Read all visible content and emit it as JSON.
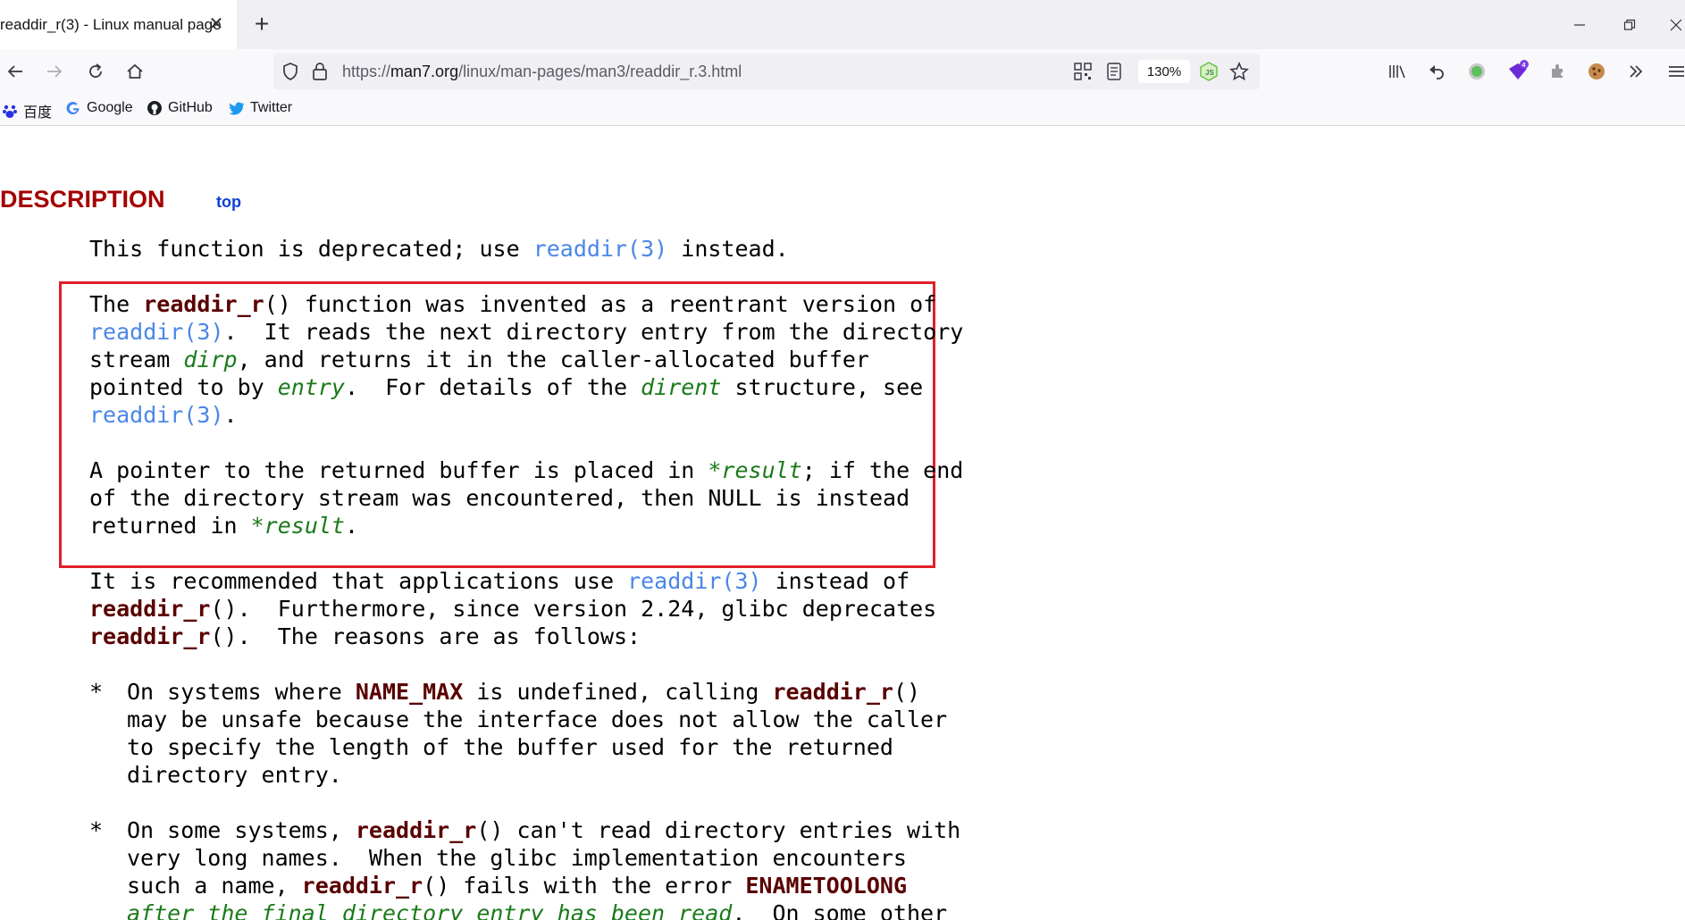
{
  "tab": {
    "title": "readdir_r(3) - Linux manual page",
    "close": "✕",
    "new_tab": "+"
  },
  "window": {
    "minimize": "—",
    "restore": "❐",
    "close": "✕"
  },
  "address": {
    "prefix": "https://",
    "domain": "man7.org",
    "path": "/linux/man-pages/man3/readdir_r.3.html",
    "zoom": "130%"
  },
  "bookmarks": [
    {
      "label": "百度",
      "icon": "baidu-icon"
    },
    {
      "label": "Google",
      "icon": "google-icon"
    },
    {
      "label": "GitHub",
      "icon": "github-icon"
    },
    {
      "label": "Twitter",
      "icon": "twitter-icon"
    }
  ],
  "page": {
    "section": "DESCRIPTION",
    "top_link": "top",
    "p1": {
      "a": "This function is deprecated; use ",
      "link": "readdir(3)",
      "b": " instead."
    },
    "p2": {
      "l1a": "The ",
      "l1b": "readdir_r",
      "l1c": "() function was invented as a reentrant version of",
      "l2a": "readdir(3)",
      "l2b": ".  It reads the next directory entry from the directory",
      "l3a": "stream ",
      "l3b": "dirp",
      "l3c": ", and returns it in the caller-allocated buffer",
      "l4a": "pointed to by ",
      "l4b": "entry",
      "l4c": ".  For details of the ",
      "l4d": "dirent",
      "l4e": " structure, see",
      "l5a": "readdir(3)",
      "l5b": "."
    },
    "p3": {
      "l1a": "A pointer to the returned buffer is placed in ",
      "l1b": "*result",
      "l1c": "; if the end",
      "l2": "of the directory stream was encountered, then NULL is instead",
      "l3a": "returned in ",
      "l3b": "*result",
      "l3c": "."
    },
    "p4": {
      "l1a": "It is recommended that applications use ",
      "l1b": "readdir(3)",
      "l1c": " instead of",
      "l2a": "readdir_r",
      "l2b": "().  Furthermore, since version 2.24, glibc deprecates",
      "l3a": "readdir_r",
      "l3b": "().  The reasons are as follows:"
    },
    "b1": {
      "star": "*",
      "l1a": "On systems where ",
      "l1b": "NAME_MAX",
      "l1c": " is undefined, calling ",
      "l1d": "readdir_r",
      "l1e": "()",
      "l2": "may be unsafe because the interface does not allow the caller",
      "l3": "to specify the length of the buffer used for the returned",
      "l4": "directory entry."
    },
    "b2": {
      "star": "*",
      "l1a": "On some systems, ",
      "l1b": "readdir_r",
      "l1c": "() can't read directory entries with",
      "l2": "very long names.  When the glibc implementation encounters",
      "l3a": "such a name, ",
      "l3b": "readdir_r",
      "l3c": "() fails with the error ",
      "l3d": "ENAMETOOLONG",
      "l4a": "after the final directory entry has been read",
      "l4b": ".  On some other"
    }
  }
}
